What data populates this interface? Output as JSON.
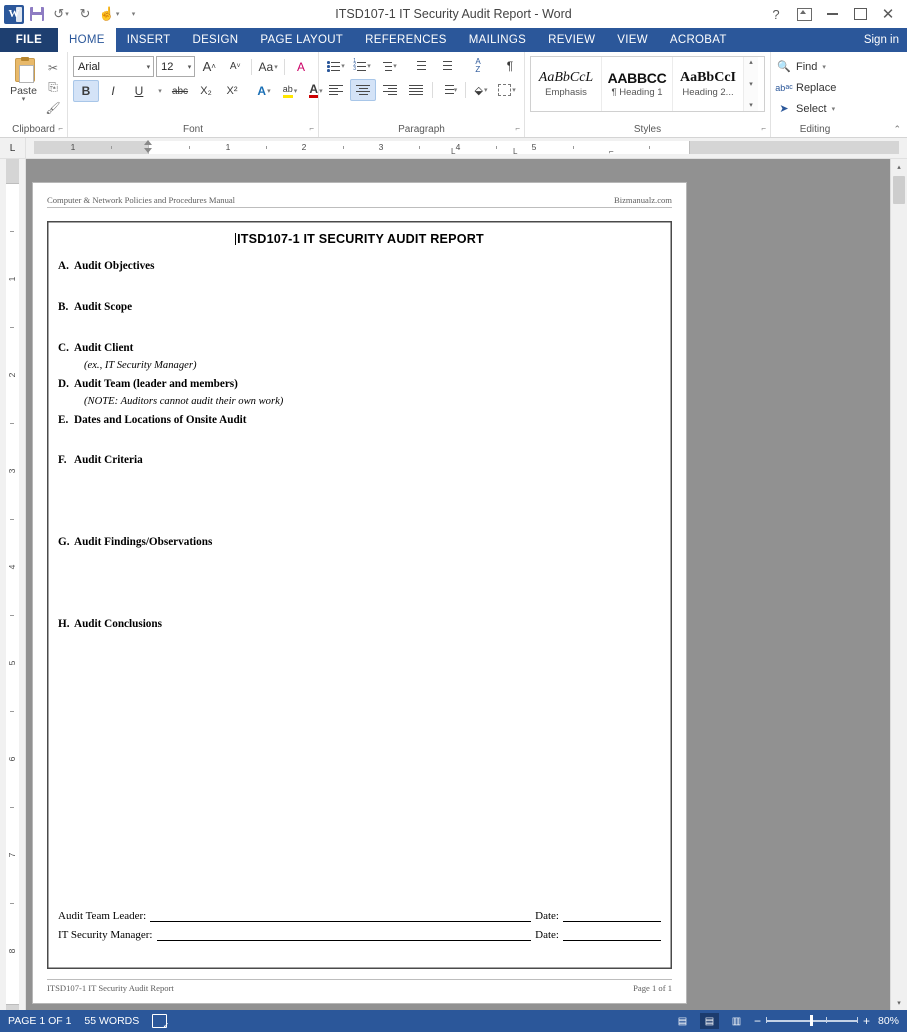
{
  "window": {
    "title": "ITSD107-1 IT Security Audit Report - Word",
    "help_icon": "?",
    "ribbon_display_icon": "ribbon-display-options-icon",
    "minimize_icon": "minimize-icon",
    "restore_icon": "restore-icon",
    "close_icon": "✕",
    "sign_in": "Sign in"
  },
  "quick_access": {
    "word_logo": "word-logo",
    "save": "save-icon",
    "undo": "↺",
    "redo": "↻",
    "touch_mode": "touch-mouse-mode-icon",
    "customize": "▾"
  },
  "tabs": [
    {
      "label": "FILE",
      "active": false
    },
    {
      "label": "HOME",
      "active": true
    },
    {
      "label": "INSERT",
      "active": false
    },
    {
      "label": "DESIGN",
      "active": false
    },
    {
      "label": "PAGE LAYOUT",
      "active": false
    },
    {
      "label": "REFERENCES",
      "active": false
    },
    {
      "label": "MAILINGS",
      "active": false
    },
    {
      "label": "REVIEW",
      "active": false
    },
    {
      "label": "VIEW",
      "active": false
    },
    {
      "label": "ACROBAT",
      "active": false
    }
  ],
  "ribbon": {
    "clipboard": {
      "label": "Clipboard",
      "paste_label": "Paste",
      "cut": "✂",
      "copy": "⎘",
      "format_painter": "🖌"
    },
    "font": {
      "label": "Font",
      "font_name": "Arial",
      "font_size": "12",
      "grow_font": "A",
      "shrink_font": "A",
      "change_case": "Aa",
      "clear_formatting": "A",
      "bold": "B",
      "italic": "I",
      "underline": "U",
      "strikethrough": "abc",
      "subscript": "X₂",
      "superscript": "X²",
      "text_effects": "A",
      "highlight": "ab",
      "font_color": "A"
    },
    "paragraph": {
      "label": "Paragraph",
      "bullets": "bullets-icon",
      "numbering": "numbering-icon",
      "multilevel": "multilevel-list-icon",
      "decrease_indent": "decrease-indent-icon",
      "increase_indent": "increase-indent-icon",
      "sort": "A\nZ",
      "show_marks": "¶",
      "align_left": "align-left-icon",
      "align_center": "align-center-icon",
      "align_right": "align-right-icon",
      "justify": "justify-icon",
      "line_spacing": "line-spacing-icon",
      "shading": "shading-icon",
      "borders": "borders-icon"
    },
    "styles": {
      "label": "Styles",
      "items": [
        {
          "preview": "AaBbCcL",
          "name": "Emphasis"
        },
        {
          "preview": "AABBCC",
          "name": "¶ Heading 1"
        },
        {
          "preview": "AaBbCcI",
          "name": "Heading 2..."
        }
      ],
      "scroll_up": "▴",
      "scroll_down": "▾",
      "more": "▾"
    },
    "editing": {
      "label": "Editing",
      "find": "Find",
      "find_caret": "▾",
      "replace": "Replace",
      "select": "Select",
      "select_caret": "▾"
    },
    "collapse_ribbon": "⌃",
    "dialog_launcher": "⌐"
  },
  "ruler": {
    "tab_selector": "L",
    "horizontal_numbers": [
      "1",
      "1",
      "2",
      "3",
      "4",
      "5"
    ],
    "vertical_numbers": [
      "1",
      "2",
      "3",
      "4",
      "5",
      "6",
      "7",
      "8"
    ]
  },
  "document": {
    "header": {
      "left": "Computer & Network Policies and Procedures Manual",
      "right": "Bizmanualz.com"
    },
    "title": "ITSD107-1   IT SECURITY AUDIT REPORT",
    "sections": [
      {
        "letter": "A.",
        "text": "Audit Objectives",
        "note": ""
      },
      {
        "letter": "B.",
        "text": "Audit Scope",
        "note": ""
      },
      {
        "letter": "C.",
        "text": "Audit Client",
        "note": "(ex., IT Security Manager)"
      },
      {
        "letter": "D.",
        "text": "Audit Team (leader and members)",
        "note": "(NOTE: Auditors cannot audit their own work)"
      },
      {
        "letter": "E.",
        "text": "Dates and Locations of Onsite Audit",
        "note": ""
      },
      {
        "letter": "F.",
        "text": "Audit Criteria",
        "note": ""
      },
      {
        "letter": "G.",
        "text": "Audit Findings/Observations",
        "note": ""
      },
      {
        "letter": "H.",
        "text": "Audit Conclusions",
        "note": ""
      }
    ],
    "signatures": [
      {
        "label": "Audit Team Leader:",
        "date_label": "Date:"
      },
      {
        "label": "IT Security Manager:",
        "date_label": "Date:"
      }
    ],
    "footer": {
      "left": "ITSD107-1 IT Security Audit Report",
      "right": "Page 1 of 1"
    }
  },
  "status_bar": {
    "page": "PAGE 1 OF 1",
    "words": "55 WORDS",
    "proofing_icon": "proofing-errors-icon",
    "read_mode": "read-mode-icon",
    "print_layout": "print-layout-icon",
    "web_layout": "web-layout-icon",
    "zoom_out": "−",
    "zoom_in": "+",
    "zoom_level": "80%"
  }
}
